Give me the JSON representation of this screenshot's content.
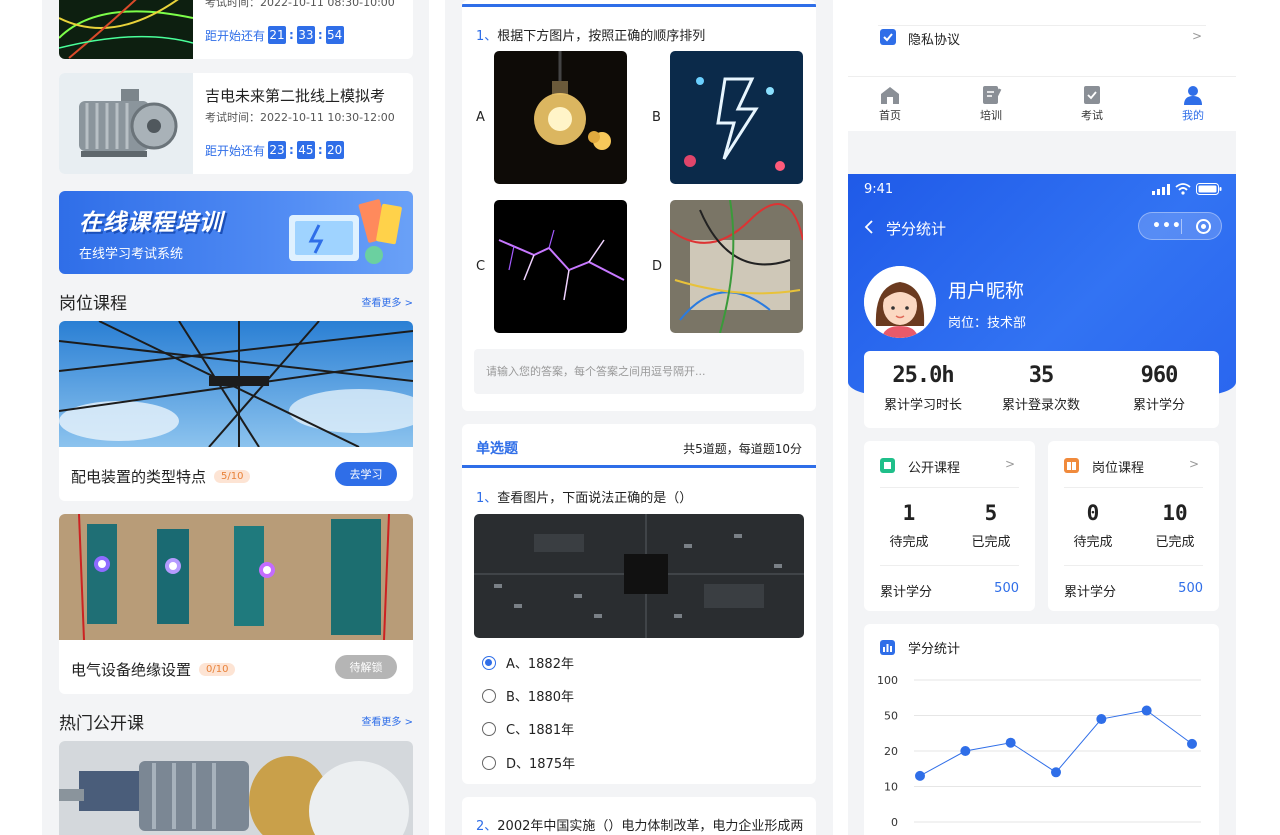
{
  "col1": {
    "exams": [
      {
        "title": "",
        "time": "考试时间：2022-10-11  08:30-10:00",
        "countdown_label": "距开始还有",
        "h": "21",
        "m": "33",
        "s": "54"
      },
      {
        "title": "吉电未来第二批线上模拟考",
        "time": "考试时间：2022-10-11  10:30-12:00",
        "countdown_label": "距开始还有",
        "h": "23",
        "m": "45",
        "s": "20"
      }
    ],
    "banner": {
      "title": "在线课程培训",
      "subtitle": "在线学习考试系统"
    },
    "post_courses": {
      "title": "岗位课程",
      "more": "查看更多 >"
    },
    "courses": [
      {
        "name": "配电装置的类型特点",
        "progress": "5/10",
        "button": "去学习"
      },
      {
        "name": "电气设备绝缘设置",
        "progress": "0/10",
        "button": "待解锁"
      }
    ],
    "hot_courses": {
      "title": "热门公开课",
      "more": "查看更多 >"
    }
  },
  "col2": {
    "q1": {
      "num": "1、",
      "text": "根据下方图片，按照正确的顺序排列",
      "options": [
        "A",
        "B",
        "C",
        "D"
      ],
      "answer_placeholder": "请输入您的答案，每个答案之间用逗号隔开..."
    },
    "single": {
      "title": "单选题",
      "info": "共5道题，每道题10分",
      "question_num": "1、",
      "question": "查看图片，下面说法正确的是（）",
      "options": [
        {
          "label": "A、1882年",
          "checked": true
        },
        {
          "label": "B、1880年",
          "checked": false
        },
        {
          "label": "C、1881年",
          "checked": false
        },
        {
          "label": "D、1875年",
          "checked": false
        }
      ]
    },
    "q2": {
      "num": "2、",
      "text": "2002年中国实施（）电力体制改革，电力企业形成两"
    }
  },
  "col3": {
    "menu_privacy": "隐私协议",
    "menu_arrow": ">",
    "tabs": [
      {
        "label": "首页",
        "icon": "home-icon"
      },
      {
        "label": "培训",
        "icon": "training-icon"
      },
      {
        "label": "考试",
        "icon": "exam-icon"
      },
      {
        "label": "我的",
        "icon": "user-icon"
      }
    ],
    "phone": {
      "status_time": "9:41",
      "nav_title": "学分统计",
      "capsule_dots": "•••",
      "user_name": "用户昵称",
      "user_post": "岗位：技术部",
      "stats": [
        {
          "value": "25.0h",
          "label": "累计学习时长"
        },
        {
          "value": "35",
          "label": "累计登录次数"
        },
        {
          "value": "960",
          "label": "累计学分"
        }
      ],
      "public_course": {
        "title": "公开课程",
        "arrow": ">",
        "todo_num": "1",
        "todo_label": "待完成",
        "done_num": "5",
        "done_label": "已完成",
        "total_label": "累计学分",
        "total_value": "500"
      },
      "post_course": {
        "title": "岗位课程",
        "arrow": ">",
        "todo_num": "0",
        "todo_label": "待完成",
        "done_num": "10",
        "done_label": "已完成",
        "total_label": "累计学分",
        "total_value": "500"
      },
      "chart_title": "学分统计"
    },
    "colors": {
      "accent": "#2f6ee8",
      "public_icon": "#1fbf8a",
      "post_icon": "#f08a3c"
    }
  },
  "chart_data": {
    "type": "line",
    "title": "学分统计",
    "y_ticks": [
      "100",
      "50",
      "20",
      "10",
      "0"
    ],
    "values": [
      13,
      20,
      27,
      14,
      47,
      57,
      26
    ],
    "x_labels_cut_off": true
  }
}
